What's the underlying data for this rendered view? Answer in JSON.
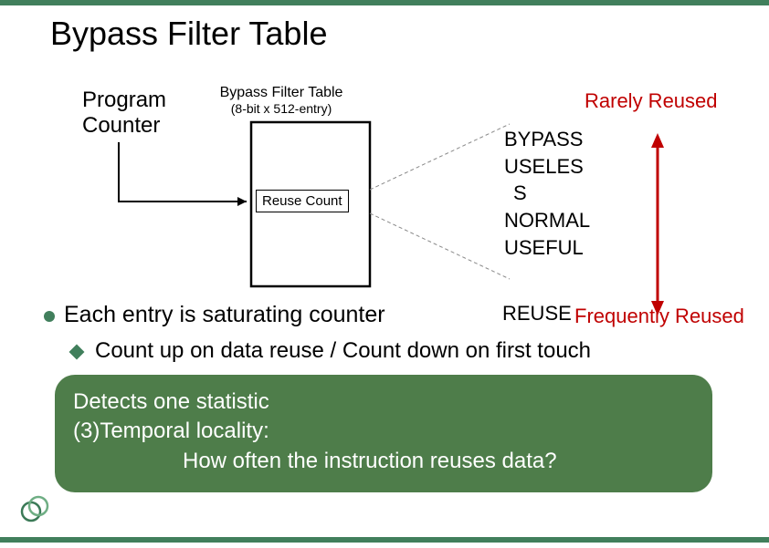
{
  "title": "Bypass Filter Table",
  "pc_label_line1": "Program",
  "pc_label_line2": "Counter",
  "bft_caption": "Bypass Filter Table",
  "bft_sub": "(8-bit x 512-entry)",
  "reuse_count": "Reuse Count",
  "states": {
    "s1": "BYPASS",
    "s2a": "USELES",
    "s2b": "S",
    "s3": "NORMAL",
    "s4": "USEFUL"
  },
  "rarely": "Rarely Reused",
  "bullet_main_prefix": "Each entry is saturating counter",
  "reuse_word": "REUSE",
  "frequently": "Frequently Reused",
  "sub_bullet": "Count up on data reuse / Count down on first touch",
  "green": {
    "l1": "Detects one statistic",
    "l2": "(3)Temporal locality:",
    "l3": "How often the instruction reuses data?"
  }
}
